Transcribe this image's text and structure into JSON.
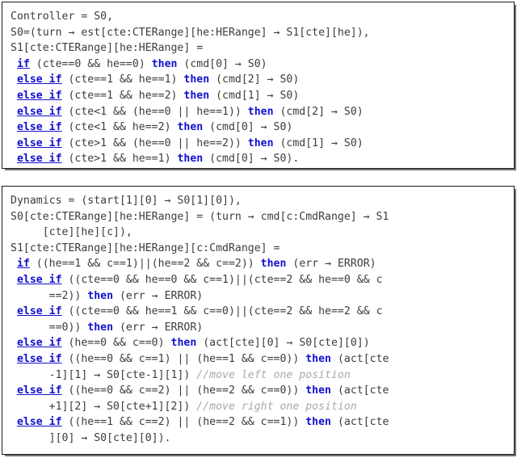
{
  "figure": {
    "title_hidden": "",
    "colors": {
      "keyword_blue": "#1010d0",
      "code_text": "#3c3c3c",
      "comment_gray": "#a8a8a8",
      "box_border": "#1a1a1a",
      "background": "#ffffff"
    }
  },
  "blocks": [
    {
      "id": "controller",
      "name": "Controller",
      "lines": [
        {
          "indent": 0,
          "tokens": [
            {
              "t": "text",
              "v": "Controller = S0,"
            }
          ]
        },
        {
          "indent": 0,
          "tokens": [
            {
              "t": "text",
              "v": "S0=(turn → est[cte:CTERange][he:HERange] → S1[cte][he]),"
            }
          ]
        },
        {
          "indent": 0,
          "tokens": [
            {
              "t": "text",
              "v": "S1[cte:CTERange][he:HERange] ="
            }
          ]
        },
        {
          "indent": 1,
          "tokens": [
            {
              "t": "kw-u",
              "v": "if"
            },
            {
              "t": "text",
              "v": " (cte==0 && he==0) "
            },
            {
              "t": "kw",
              "v": "then"
            },
            {
              "t": "text",
              "v": " (cmd[0] → S0)"
            }
          ]
        },
        {
          "indent": 1,
          "tokens": [
            {
              "t": "kw-u",
              "v": "else if"
            },
            {
              "t": "text",
              "v": " (cte==1 && he==1) "
            },
            {
              "t": "kw",
              "v": "then"
            },
            {
              "t": "text",
              "v": " (cmd[2] → S0)"
            }
          ]
        },
        {
          "indent": 1,
          "tokens": [
            {
              "t": "kw-u",
              "v": "else if"
            },
            {
              "t": "text",
              "v": " (cte==1 && he==2) "
            },
            {
              "t": "kw",
              "v": "then"
            },
            {
              "t": "text",
              "v": " (cmd[1] → S0)"
            }
          ]
        },
        {
          "indent": 1,
          "tokens": [
            {
              "t": "kw-u",
              "v": "else if"
            },
            {
              "t": "text",
              "v": " (cte<1 && (he==0 || he==1)) "
            },
            {
              "t": "kw",
              "v": "then"
            },
            {
              "t": "text",
              "v": " (cmd[2] → S0)"
            }
          ]
        },
        {
          "indent": 1,
          "tokens": [
            {
              "t": "kw-u",
              "v": "else if"
            },
            {
              "t": "text",
              "v": " (cte<1 && he==2) "
            },
            {
              "t": "kw",
              "v": "then"
            },
            {
              "t": "text",
              "v": " (cmd[0] → S0)"
            }
          ]
        },
        {
          "indent": 1,
          "tokens": [
            {
              "t": "kw-u",
              "v": "else if"
            },
            {
              "t": "text",
              "v": " (cte>1 && (he==0 || he==2)) "
            },
            {
              "t": "kw",
              "v": "then"
            },
            {
              "t": "text",
              "v": " (cmd[1] → S0)"
            }
          ]
        },
        {
          "indent": 1,
          "tokens": [
            {
              "t": "kw-u",
              "v": "else if"
            },
            {
              "t": "text",
              "v": " (cte>1 && he==1) "
            },
            {
              "t": "kw",
              "v": "then"
            },
            {
              "t": "text",
              "v": " (cmd[0] → S0)."
            }
          ]
        }
      ]
    },
    {
      "id": "dynamics",
      "name": "Dynamics",
      "lines": [
        {
          "indent": 0,
          "tokens": [
            {
              "t": "text",
              "v": "Dynamics = (start[1][0] → S0[1][0]),"
            }
          ]
        },
        {
          "indent": 0,
          "tokens": [
            {
              "t": "text",
              "v": "S0[cte:CTERange][he:HERange] = (turn → cmd[c:CmdRange] → S1"
            }
          ]
        },
        {
          "indent": 5,
          "tokens": [
            {
              "t": "text",
              "v": "[cte][he][c]),"
            }
          ]
        },
        {
          "indent": 0,
          "tokens": [
            {
              "t": "text",
              "v": "S1[cte:CTERange][he:HERange][c:CmdRange] ="
            }
          ]
        },
        {
          "indent": 1,
          "tokens": [
            {
              "t": "kw-u",
              "v": "if"
            },
            {
              "t": "text",
              "v": " ((he==1 && c==1)||(he==2 && c==2)) "
            },
            {
              "t": "kw",
              "v": "then"
            },
            {
              "t": "text",
              "v": " (err → ERROR)"
            }
          ]
        },
        {
          "indent": 1,
          "tokens": [
            {
              "t": "kw-u",
              "v": "else if"
            },
            {
              "t": "text",
              "v": " ((cte==0 && he==0 && c==1)||(cte==2 && he==0 && c"
            }
          ]
        },
        {
          "indent": 6,
          "tokens": [
            {
              "t": "text",
              "v": "==2)) "
            },
            {
              "t": "kw",
              "v": "then"
            },
            {
              "t": "text",
              "v": " (err → ERROR)"
            }
          ]
        },
        {
          "indent": 1,
          "tokens": [
            {
              "t": "kw-u",
              "v": "else if"
            },
            {
              "t": "text",
              "v": " ((cte==0 && he==1 && c==0)||(cte==2 && he==2 && c"
            }
          ]
        },
        {
          "indent": 6,
          "tokens": [
            {
              "t": "text",
              "v": "==0)) "
            },
            {
              "t": "kw",
              "v": "then"
            },
            {
              "t": "text",
              "v": " (err → ERROR)"
            }
          ]
        },
        {
          "indent": 1,
          "tokens": [
            {
              "t": "kw-u",
              "v": "else if"
            },
            {
              "t": "text",
              "v": " (he==0 && c==0) "
            },
            {
              "t": "kw",
              "v": "then"
            },
            {
              "t": "text",
              "v": " (act[cte][0] → S0[cte][0])"
            }
          ]
        },
        {
          "indent": 1,
          "tokens": [
            {
              "t": "kw-u",
              "v": "else if"
            },
            {
              "t": "text",
              "v": " ((he==0 && c==1) || (he==1 && c==0)) "
            },
            {
              "t": "kw",
              "v": "then"
            },
            {
              "t": "text",
              "v": " (act[cte"
            }
          ]
        },
        {
          "indent": 6,
          "tokens": [
            {
              "t": "text",
              "v": "-1][1] → S0[cte-1][1]) "
            },
            {
              "t": "cmt",
              "v": "//move left one position"
            }
          ]
        },
        {
          "indent": 1,
          "tokens": [
            {
              "t": "kw-u",
              "v": "else if"
            },
            {
              "t": "text",
              "v": " ((he==0 && c==2) || (he==2 && c==0)) "
            },
            {
              "t": "kw",
              "v": "then"
            },
            {
              "t": "text",
              "v": " (act[cte"
            }
          ]
        },
        {
          "indent": 6,
          "tokens": [
            {
              "t": "text",
              "v": "+1][2] → S0[cte+1][2]) "
            },
            {
              "t": "cmt",
              "v": "//move right one position"
            }
          ]
        },
        {
          "indent": 1,
          "tokens": [
            {
              "t": "kw-u",
              "v": "else if"
            },
            {
              "t": "text",
              "v": " ((he==1 && c==2) || (he==2 && c==1)) "
            },
            {
              "t": "kw",
              "v": "then"
            },
            {
              "t": "text",
              "v": " (act[cte"
            }
          ]
        },
        {
          "indent": 6,
          "tokens": [
            {
              "t": "text",
              "v": "][0] → S0[cte][0])."
            }
          ]
        }
      ]
    }
  ]
}
